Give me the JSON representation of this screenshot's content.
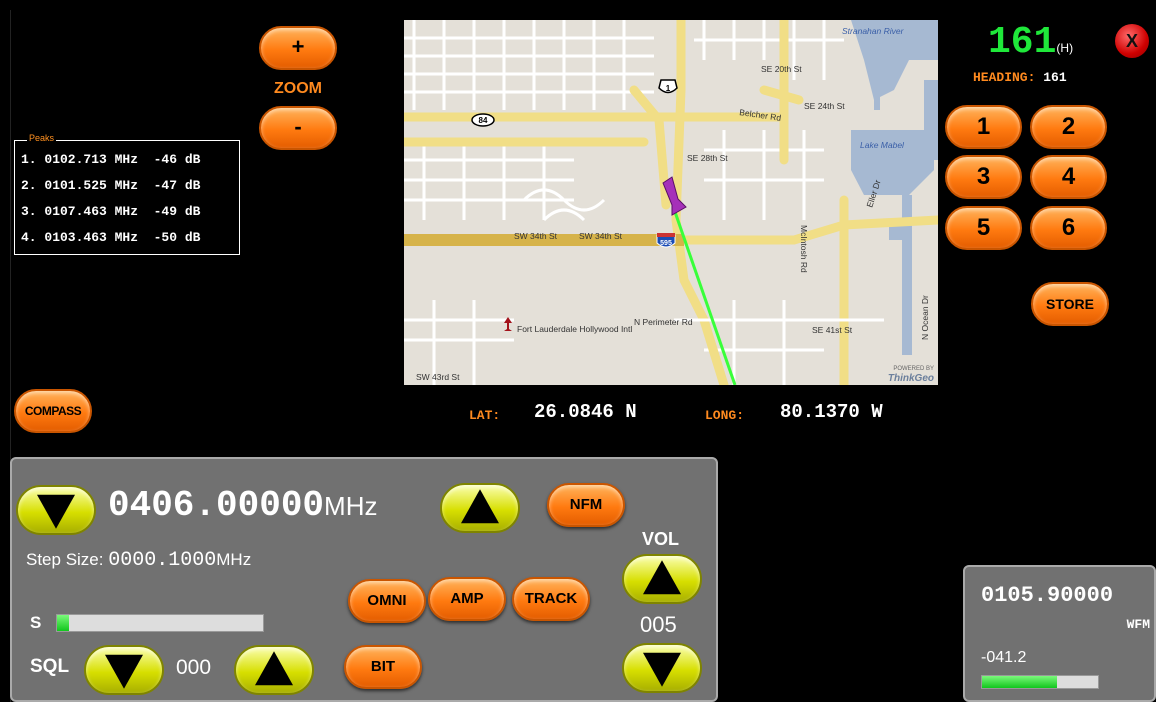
{
  "zoom": {
    "plus_label": "+",
    "label": "ZOOM",
    "minus_label": "-"
  },
  "peaks": {
    "legend": "Peaks",
    "items": [
      {
        "text": "1. 0102.713 MHz  -46 dB"
      },
      {
        "text": "2. 0101.525 MHz  -47 dB"
      },
      {
        "text": "3. 0107.463 MHz  -49 dB"
      },
      {
        "text": "4. 0103.463 MHz  -50 dB"
      }
    ]
  },
  "compass_label": "COMPASS",
  "map": {
    "labels": {
      "river": "Stranahan River",
      "se20": "SE 20th St",
      "hwy1": "1",
      "hwy84": "84",
      "belcher": "Belcher Rd",
      "se24": "SE 24th St",
      "lake": "Lake Mabel",
      "se28": "SE 28th St",
      "eller": "Eller Dr",
      "sw34a": "SW 34th St",
      "sw34b": "SW 34th St",
      "i595": "595",
      "mcintosh": "McIntosh Rd",
      "nocean": "N Ocean Dr",
      "perimeter": "N Perimeter Rd",
      "airport": "Fort Lauderdale Hollywood Intl",
      "se41": "SE 41st St",
      "sw43": "SW 43rd St",
      "powered": "POWERED BY",
      "brand": "ThinkGeo"
    }
  },
  "coords": {
    "lat_label": "LAT:",
    "lat_value": "26.0846 N",
    "long_label": "LONG:",
    "long_value": "80.1370 W"
  },
  "heading": {
    "big_value": "161",
    "suffix": "(H)",
    "label": "HEADING:",
    "value": "161"
  },
  "close_label": "X",
  "presets": [
    "1",
    "2",
    "3",
    "4",
    "5",
    "6"
  ],
  "store_label": "STORE",
  "radio": {
    "frequency": "0406.00000",
    "frequency_unit": "MHz",
    "mode_label": "NFM",
    "step_label": "Step Size:",
    "step_value": "0000.1000",
    "step_unit": "MHz",
    "s_label": "S",
    "s_level": 0.06,
    "sql_label": "SQL",
    "sql_value": "000",
    "omni_label": "OMNI",
    "amp_label": "AMP",
    "track_label": "TRACK",
    "bit_label": "BIT",
    "vol_label": "VOL",
    "vol_value": "005"
  },
  "secondary": {
    "frequency": "0105.90000",
    "mode": "WFM",
    "level": "-041.2",
    "level_fill": 0.65
  },
  "colors": {
    "accent_orange": "#ff8a1f",
    "heading_green": "#1fe83a",
    "track_line": "#33ff33"
  }
}
